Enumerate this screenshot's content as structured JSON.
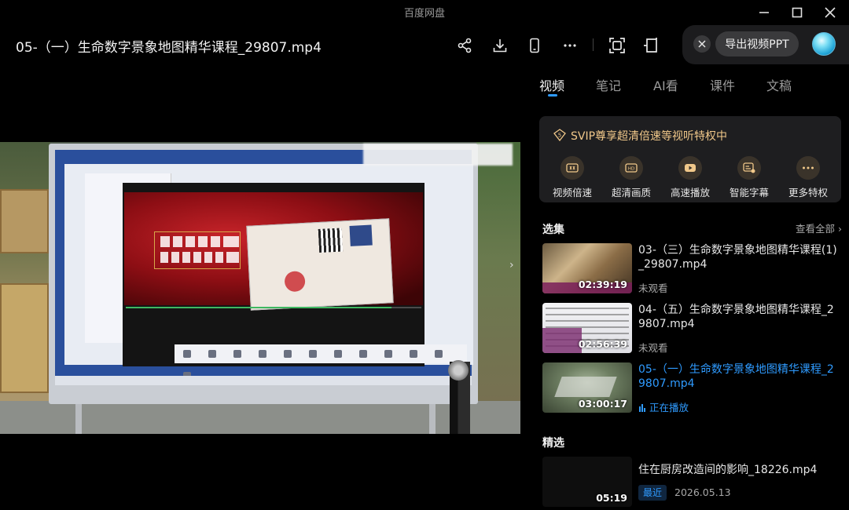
{
  "window": {
    "app_title": "百度网盘"
  },
  "header": {
    "file_title": "05-（一）生命数字景象地图精华课程_29807.mp4",
    "export_ppt_label": "导出视频PPT"
  },
  "icons": {
    "share": "share-icon",
    "download": "download-icon",
    "phone": "phone-icon",
    "more": "more-icon",
    "screenshot": "screenshot-icon",
    "popout": "popout-icon"
  },
  "tabs": [
    {
      "label": "视频",
      "active": true
    },
    {
      "label": "笔记",
      "active": false
    },
    {
      "label": "AI看",
      "active": false
    },
    {
      "label": "课件",
      "active": false
    },
    {
      "label": "文稿",
      "active": false
    }
  ],
  "svip": {
    "title": "SVIP尊享超清倍速等视听特权中",
    "features": [
      {
        "label": "视频倍速",
        "icon": "speed-icon"
      },
      {
        "label": "超清画质",
        "icon": "hd-icon"
      },
      {
        "label": "高速播放",
        "icon": "fast-play-icon"
      },
      {
        "label": "智能字幕",
        "icon": "subtitle-icon"
      },
      {
        "label": "更多特权",
        "icon": "more-dots-icon"
      }
    ]
  },
  "playlist": {
    "title": "选集",
    "see_all": "查看全部",
    "items": [
      {
        "name": "03-（三）生命数字景象地图精华课程(1)_29807.mp4",
        "duration": "02:39:19",
        "status": "未观看",
        "playing": false
      },
      {
        "name": "04-（五）生命数字景象地图精华课程_29807.mp4",
        "duration": "02:56:39",
        "status": "未观看",
        "playing": false
      },
      {
        "name": "05-（一）生命数字景象地图精华课程_29807.mp4",
        "duration": "03:00:17",
        "status": "正在播放",
        "playing": true
      }
    ]
  },
  "featured": {
    "title": "精选",
    "items": [
      {
        "name": "住在厨房改造间的影响_18226.mp4",
        "duration": "05:19",
        "tag": "最近",
        "date": "2026.05.13"
      }
    ]
  },
  "colors": {
    "accent": "#2f9bff",
    "svip_gold": "#f1c88a",
    "panel_card": "#1e1e20"
  }
}
